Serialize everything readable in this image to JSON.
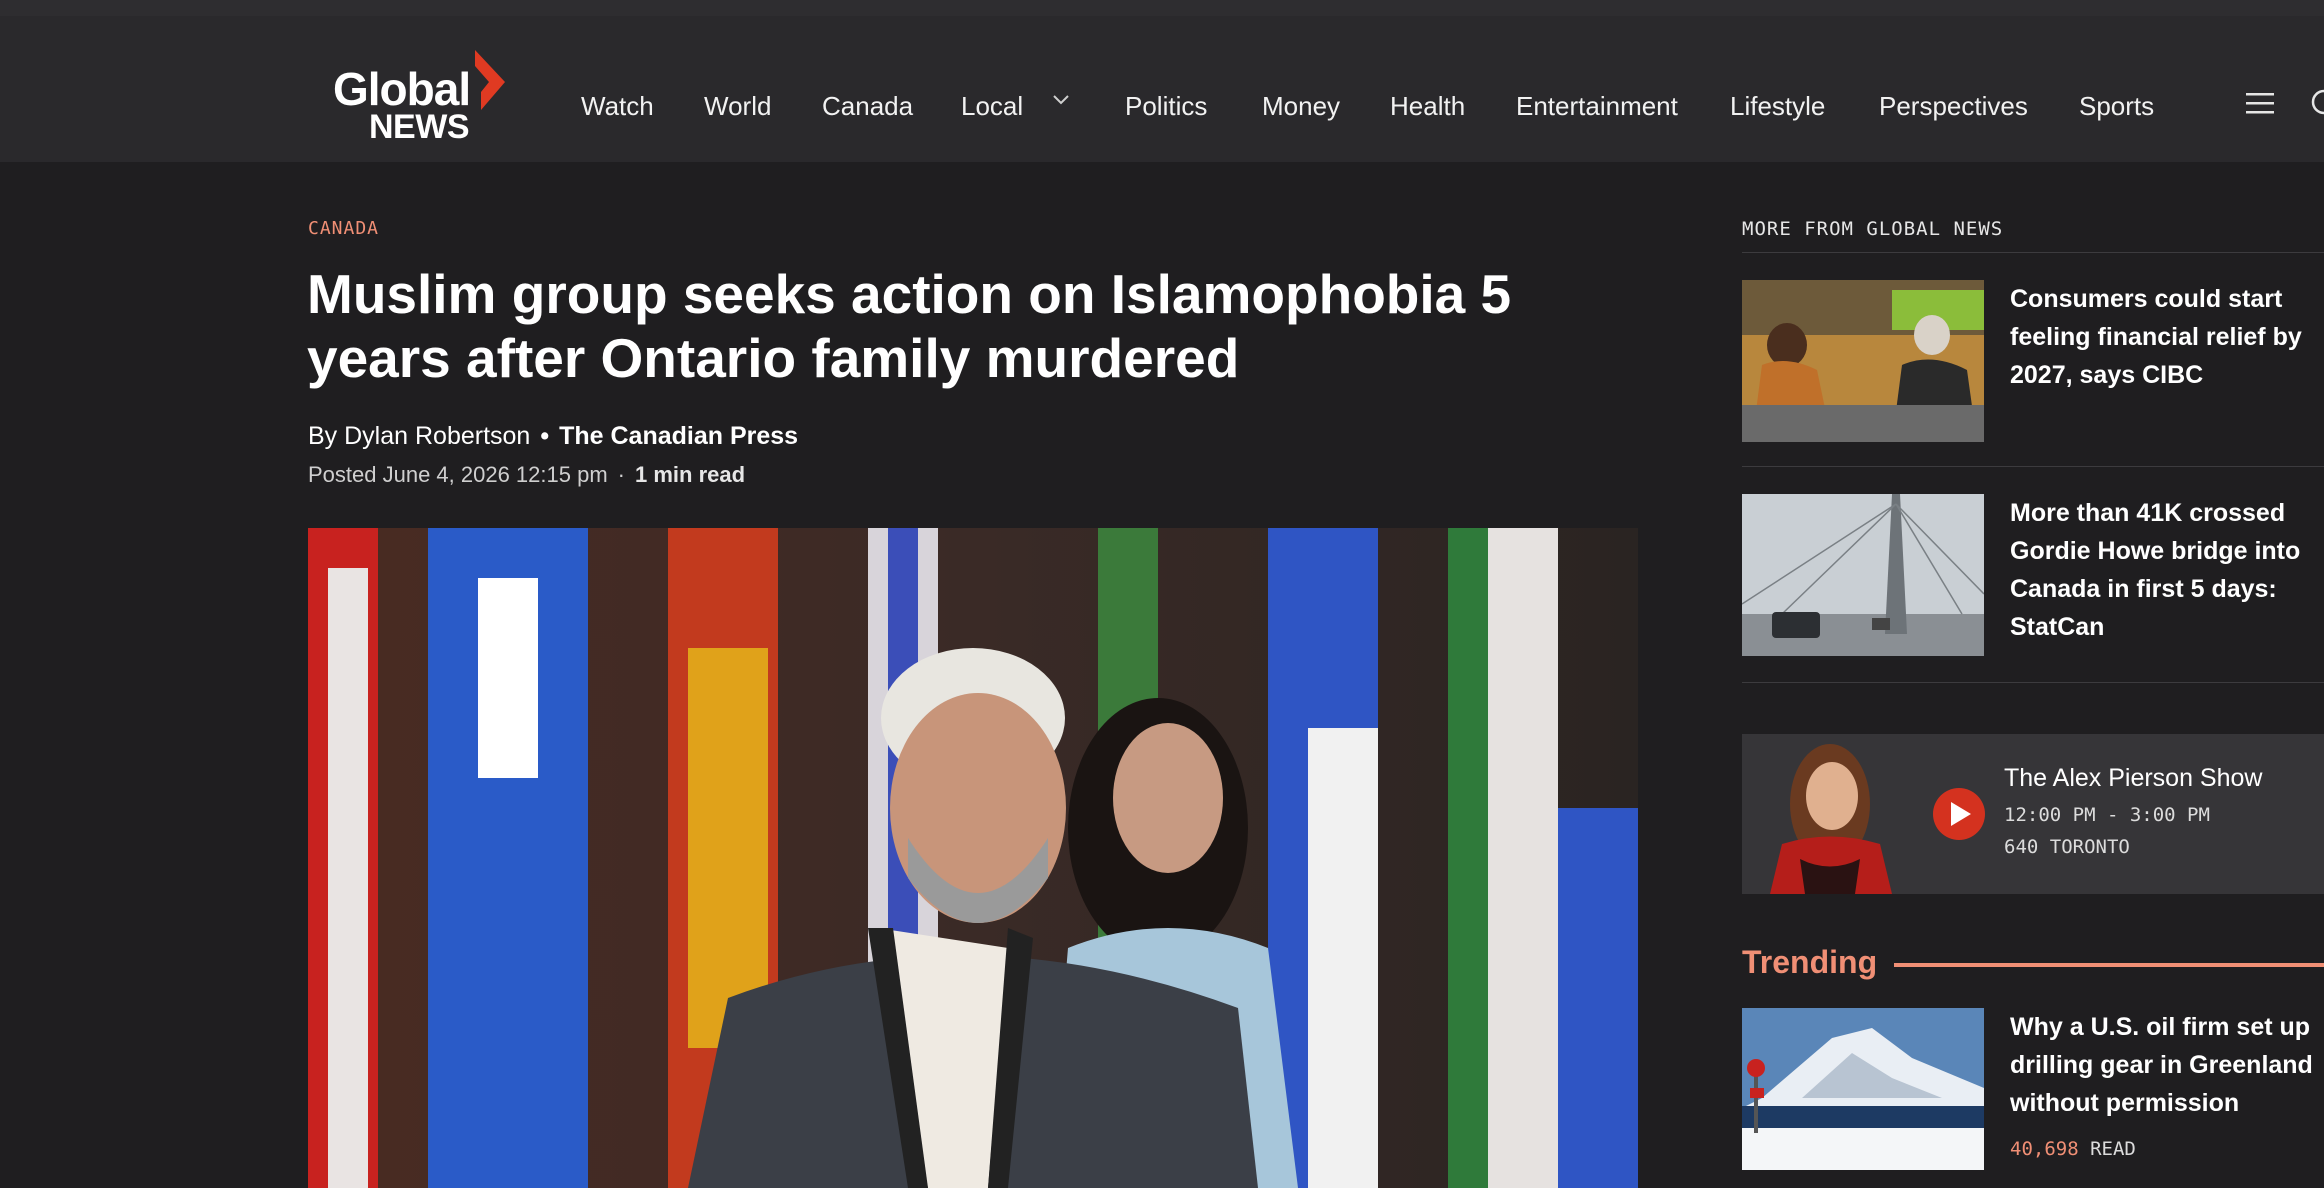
{
  "brand": {
    "logo_line1": "Global",
    "logo_line2": "NEWS",
    "accent": "#f08f75"
  },
  "nav": {
    "items": [
      "Watch",
      "World",
      "Canada",
      "Local",
      "Politics",
      "Money",
      "Health",
      "Entertainment",
      "Lifestyle",
      "Perspectives",
      "Sports"
    ],
    "icons": [
      "chevron-down-icon",
      "menu-icon",
      "search-icon"
    ]
  },
  "article": {
    "category": "CANADA",
    "headline": "Muslim group seeks action on Islamophobia 5 years after Ontario family murdered",
    "byline_prefix": "By Dylan Robertson",
    "byline_dot": "•",
    "source": "The Canadian Press",
    "posted": "Posted June 4, 2026 12:15 pm",
    "meta_sep": "·",
    "read_time": "1 min read"
  },
  "sidebar": {
    "title": "MORE FROM GLOBAL NEWS",
    "stories": [
      {
        "headline": "Consumers could start feeling financial relief by 2027, says CIBC"
      },
      {
        "headline": "More than 41K crossed Gordie Howe bridge into Canada in first 5 days: StatCan"
      }
    ],
    "radio": {
      "show": "The Alex Pierson Show",
      "time": "12:00 PM - 3:00 PM",
      "station": "640 TORONTO"
    },
    "trending": {
      "title": "Trending",
      "story": {
        "headline": "Why a U.S. oil firm set up drilling gear in Greenland without permission",
        "read_count": "40,698",
        "read_label": "READ"
      }
    }
  }
}
